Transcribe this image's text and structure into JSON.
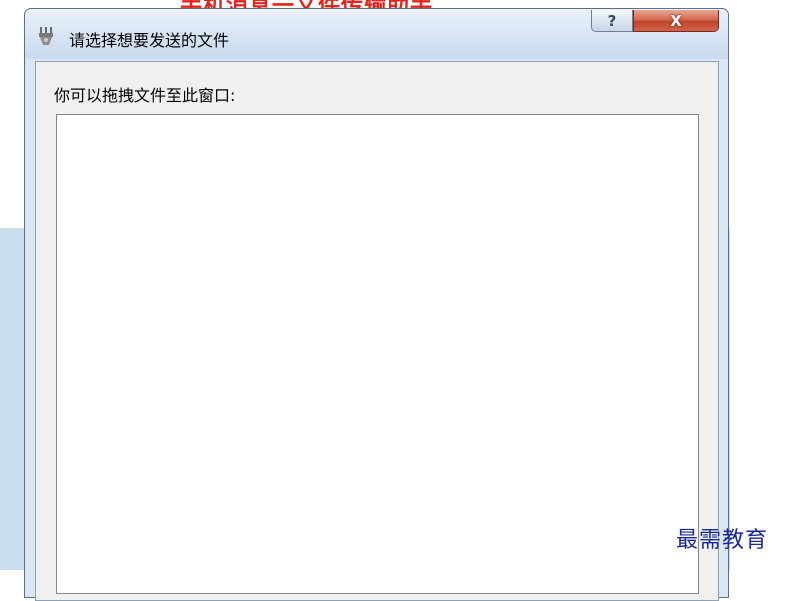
{
  "top_caption": "手机消息一文件传输助手",
  "dialog": {
    "title": "请选择想要发送的文件",
    "help_label": "?",
    "close_label": "X",
    "instruction": "你可以拖拽文件至此窗口:"
  },
  "watermark": "最需教育",
  "colors": {
    "caption": "#e8231c",
    "watermark": "#1a2a9a",
    "close_button": "#c0432a",
    "titlebar": "#d6e4f3"
  },
  "icons": {
    "app": "file-transfer-icon",
    "help": "help-icon",
    "close": "close-icon"
  }
}
